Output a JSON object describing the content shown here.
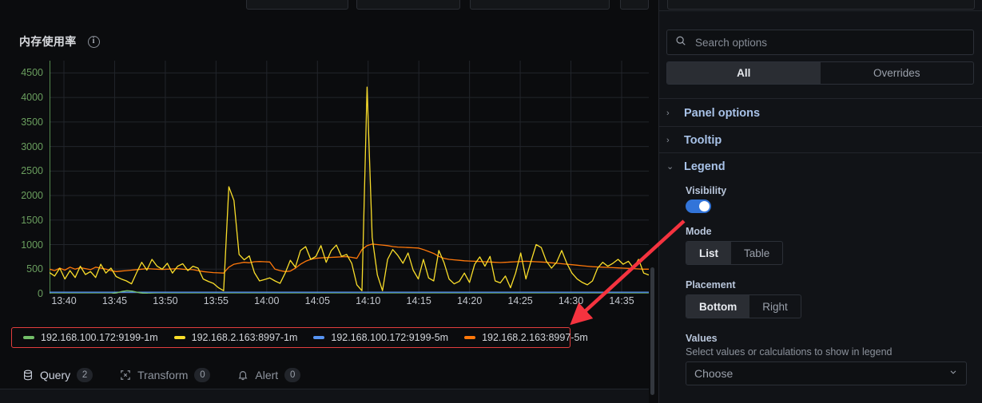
{
  "panel": {
    "title": "内存使用率",
    "info_icon": "info-circle-icon"
  },
  "chart_data": {
    "type": "line",
    "title": "内存使用率",
    "xlabel": "",
    "ylabel": "",
    "ylim": [
      0,
      4750
    ],
    "grid": true,
    "legend_position": "bottom",
    "x_ticks": [
      "13:40",
      "13:45",
      "13:50",
      "13:55",
      "14:00",
      "14:05",
      "14:10",
      "14:15",
      "14:20",
      "14:25",
      "14:30",
      "14:35"
    ],
    "y_ticks": [
      0,
      500,
      1000,
      1500,
      2000,
      2500,
      3000,
      3500,
      4000,
      4500
    ],
    "series": [
      {
        "name": "192.168.100.172:9199-1m",
        "color": "#73bf69",
        "values": [
          0,
          0,
          0,
          0,
          0,
          0,
          0,
          0,
          0,
          0,
          0,
          0,
          0,
          18,
          45,
          60,
          52,
          30,
          12,
          5,
          2,
          0,
          0,
          0,
          0,
          0,
          0,
          0,
          0,
          0,
          0,
          0,
          0,
          0,
          0,
          0,
          0,
          0,
          0,
          0,
          0,
          0,
          0,
          0,
          0,
          0,
          0,
          0,
          0,
          0,
          0,
          0,
          0,
          0,
          0,
          0,
          0,
          0,
          0,
          0,
          0,
          0,
          0,
          0,
          0,
          0,
          0,
          0,
          0,
          0,
          0,
          0,
          0,
          0,
          0,
          0,
          0,
          0,
          0,
          0,
          0,
          0,
          0,
          0,
          0,
          0,
          0,
          0,
          0,
          0,
          0,
          0,
          0,
          0,
          0,
          0,
          0,
          0,
          0,
          0,
          0,
          0,
          0,
          0,
          0,
          0,
          0,
          0,
          0,
          0,
          0,
          0,
          0,
          0,
          0,
          0,
          0
        ]
      },
      {
        "name": "192.168.2.163:8997-1m",
        "color": "#fade2a",
        "values": [
          430,
          360,
          520,
          300,
          470,
          330,
          560,
          390,
          450,
          330,
          600,
          420,
          520,
          350,
          300,
          260,
          200,
          430,
          640,
          480,
          700,
          560,
          500,
          620,
          420,
          560,
          610,
          470,
          560,
          520,
          300,
          250,
          210,
          120,
          60,
          2180,
          1900,
          800,
          690,
          770,
          430,
          260,
          290,
          320,
          260,
          210,
          420,
          680,
          540,
          880,
          960,
          700,
          760,
          980,
          640,
          880,
          990,
          760,
          800,
          620,
          180,
          60,
          4210,
          1150,
          380,
          60,
          700,
          900,
          780,
          620,
          830,
          480,
          300,
          700,
          320,
          260,
          880,
          640,
          300,
          200,
          250,
          420,
          230,
          600,
          750,
          560,
          760,
          260,
          220,
          360,
          120,
          420,
          830,
          300,
          660,
          1000,
          940,
          660,
          520,
          640,
          880,
          620,
          420,
          300,
          230,
          180,
          260,
          520,
          640,
          560,
          620,
          700,
          600,
          660,
          520,
          700,
          420,
          380
        ]
      },
      {
        "name": "192.168.100.172:9199-5m",
        "color": "#5794f2",
        "values": [
          30,
          30,
          30,
          30,
          30,
          30,
          30,
          30,
          30,
          30,
          30,
          30,
          30,
          30,
          30,
          30,
          30,
          30,
          30,
          30,
          30,
          30,
          30,
          30,
          30,
          30,
          30,
          30,
          30,
          30,
          30,
          30,
          30,
          30,
          30,
          30,
          30,
          30,
          30,
          30,
          30,
          30,
          30,
          30,
          30,
          30,
          30,
          30,
          30,
          30,
          30,
          30,
          30,
          30,
          30,
          30,
          30,
          30,
          30,
          30,
          30,
          30,
          30,
          30,
          30,
          30,
          30,
          30,
          30,
          30,
          30,
          30,
          30,
          30,
          30,
          30,
          30,
          30,
          30,
          30,
          30,
          30,
          30,
          30,
          30,
          30,
          30,
          30,
          30,
          30,
          30,
          30,
          30,
          30,
          30,
          30,
          30,
          30,
          30,
          30,
          30,
          30,
          30,
          30,
          30,
          30,
          30,
          30,
          30,
          30,
          30,
          30,
          30,
          30,
          30,
          30,
          30,
          30
        ]
      },
      {
        "name": "192.168.2.163:8997-5m",
        "color": "#ff780a",
        "values": [
          500,
          470,
          520,
          480,
          540,
          500,
          530,
          510,
          490,
          540,
          520,
          500,
          470,
          450,
          460,
          470,
          480,
          490,
          500,
          510,
          505,
          500,
          495,
          500,
          505,
          510,
          500,
          495,
          490,
          470,
          450,
          440,
          430,
          425,
          420,
          540,
          600,
          620,
          640,
          630,
          650,
          655,
          650,
          645,
          500,
          470,
          450,
          460,
          520,
          600,
          660,
          700,
          720,
          730,
          735,
          740,
          745,
          750,
          755,
          740,
          720,
          900,
          980,
          1010,
          1000,
          990,
          980,
          960,
          950,
          945,
          940,
          935,
          930,
          900,
          860,
          820,
          760,
          720,
          700,
          690,
          680,
          670,
          665,
          660,
          655,
          650,
          645,
          640,
          635,
          640,
          645,
          650,
          655,
          660,
          655,
          650,
          645,
          640,
          630,
          620,
          610,
          600,
          590,
          580,
          570,
          560,
          550,
          545,
          540,
          535,
          530,
          525,
          520,
          515,
          510,
          505,
          500,
          500
        ]
      }
    ]
  },
  "bottom_tabs": [
    {
      "label": "Query",
      "count": "2",
      "icon": "database-icon",
      "active": true
    },
    {
      "label": "Transform",
      "count": "0",
      "icon": "transform-icon",
      "active": false
    },
    {
      "label": "Alert",
      "count": "0",
      "icon": "bell-icon",
      "active": false
    }
  ],
  "options": {
    "search": {
      "placeholder": "Search options",
      "value": "",
      "icon": "search-icon"
    },
    "tabs": [
      {
        "label": "All",
        "active": true
      },
      {
        "label": "Overrides",
        "active": false
      }
    ],
    "sections": [
      {
        "label": "Panel options",
        "expanded": false,
        "chevron": "chevron-right-icon"
      },
      {
        "label": "Tooltip",
        "expanded": false,
        "chevron": "chevron-right-icon"
      },
      {
        "label": "Legend",
        "expanded": true,
        "chevron": "chevron-down-icon"
      }
    ],
    "legend_section": {
      "visibility_label": "Visibility",
      "visibility_on": true,
      "mode_label": "Mode",
      "mode_options": [
        {
          "label": "List",
          "active": true
        },
        {
          "label": "Table",
          "active": false
        }
      ],
      "placement_label": "Placement",
      "placement_options": [
        {
          "label": "Bottom",
          "active": true
        },
        {
          "label": "Right",
          "active": false
        }
      ],
      "values_label": "Values",
      "values_desc": "Select values or calculations to show in legend",
      "values_placeholder": "Choose"
    }
  },
  "colors": {
    "accent_blue": "#3274d9",
    "accent_orange": "#f05a28",
    "annotation_red": "#e23d3d",
    "series_green": "#73bf69",
    "series_yellow": "#fade2a",
    "series_blue": "#5794f2",
    "series_orange": "#ff780a"
  }
}
